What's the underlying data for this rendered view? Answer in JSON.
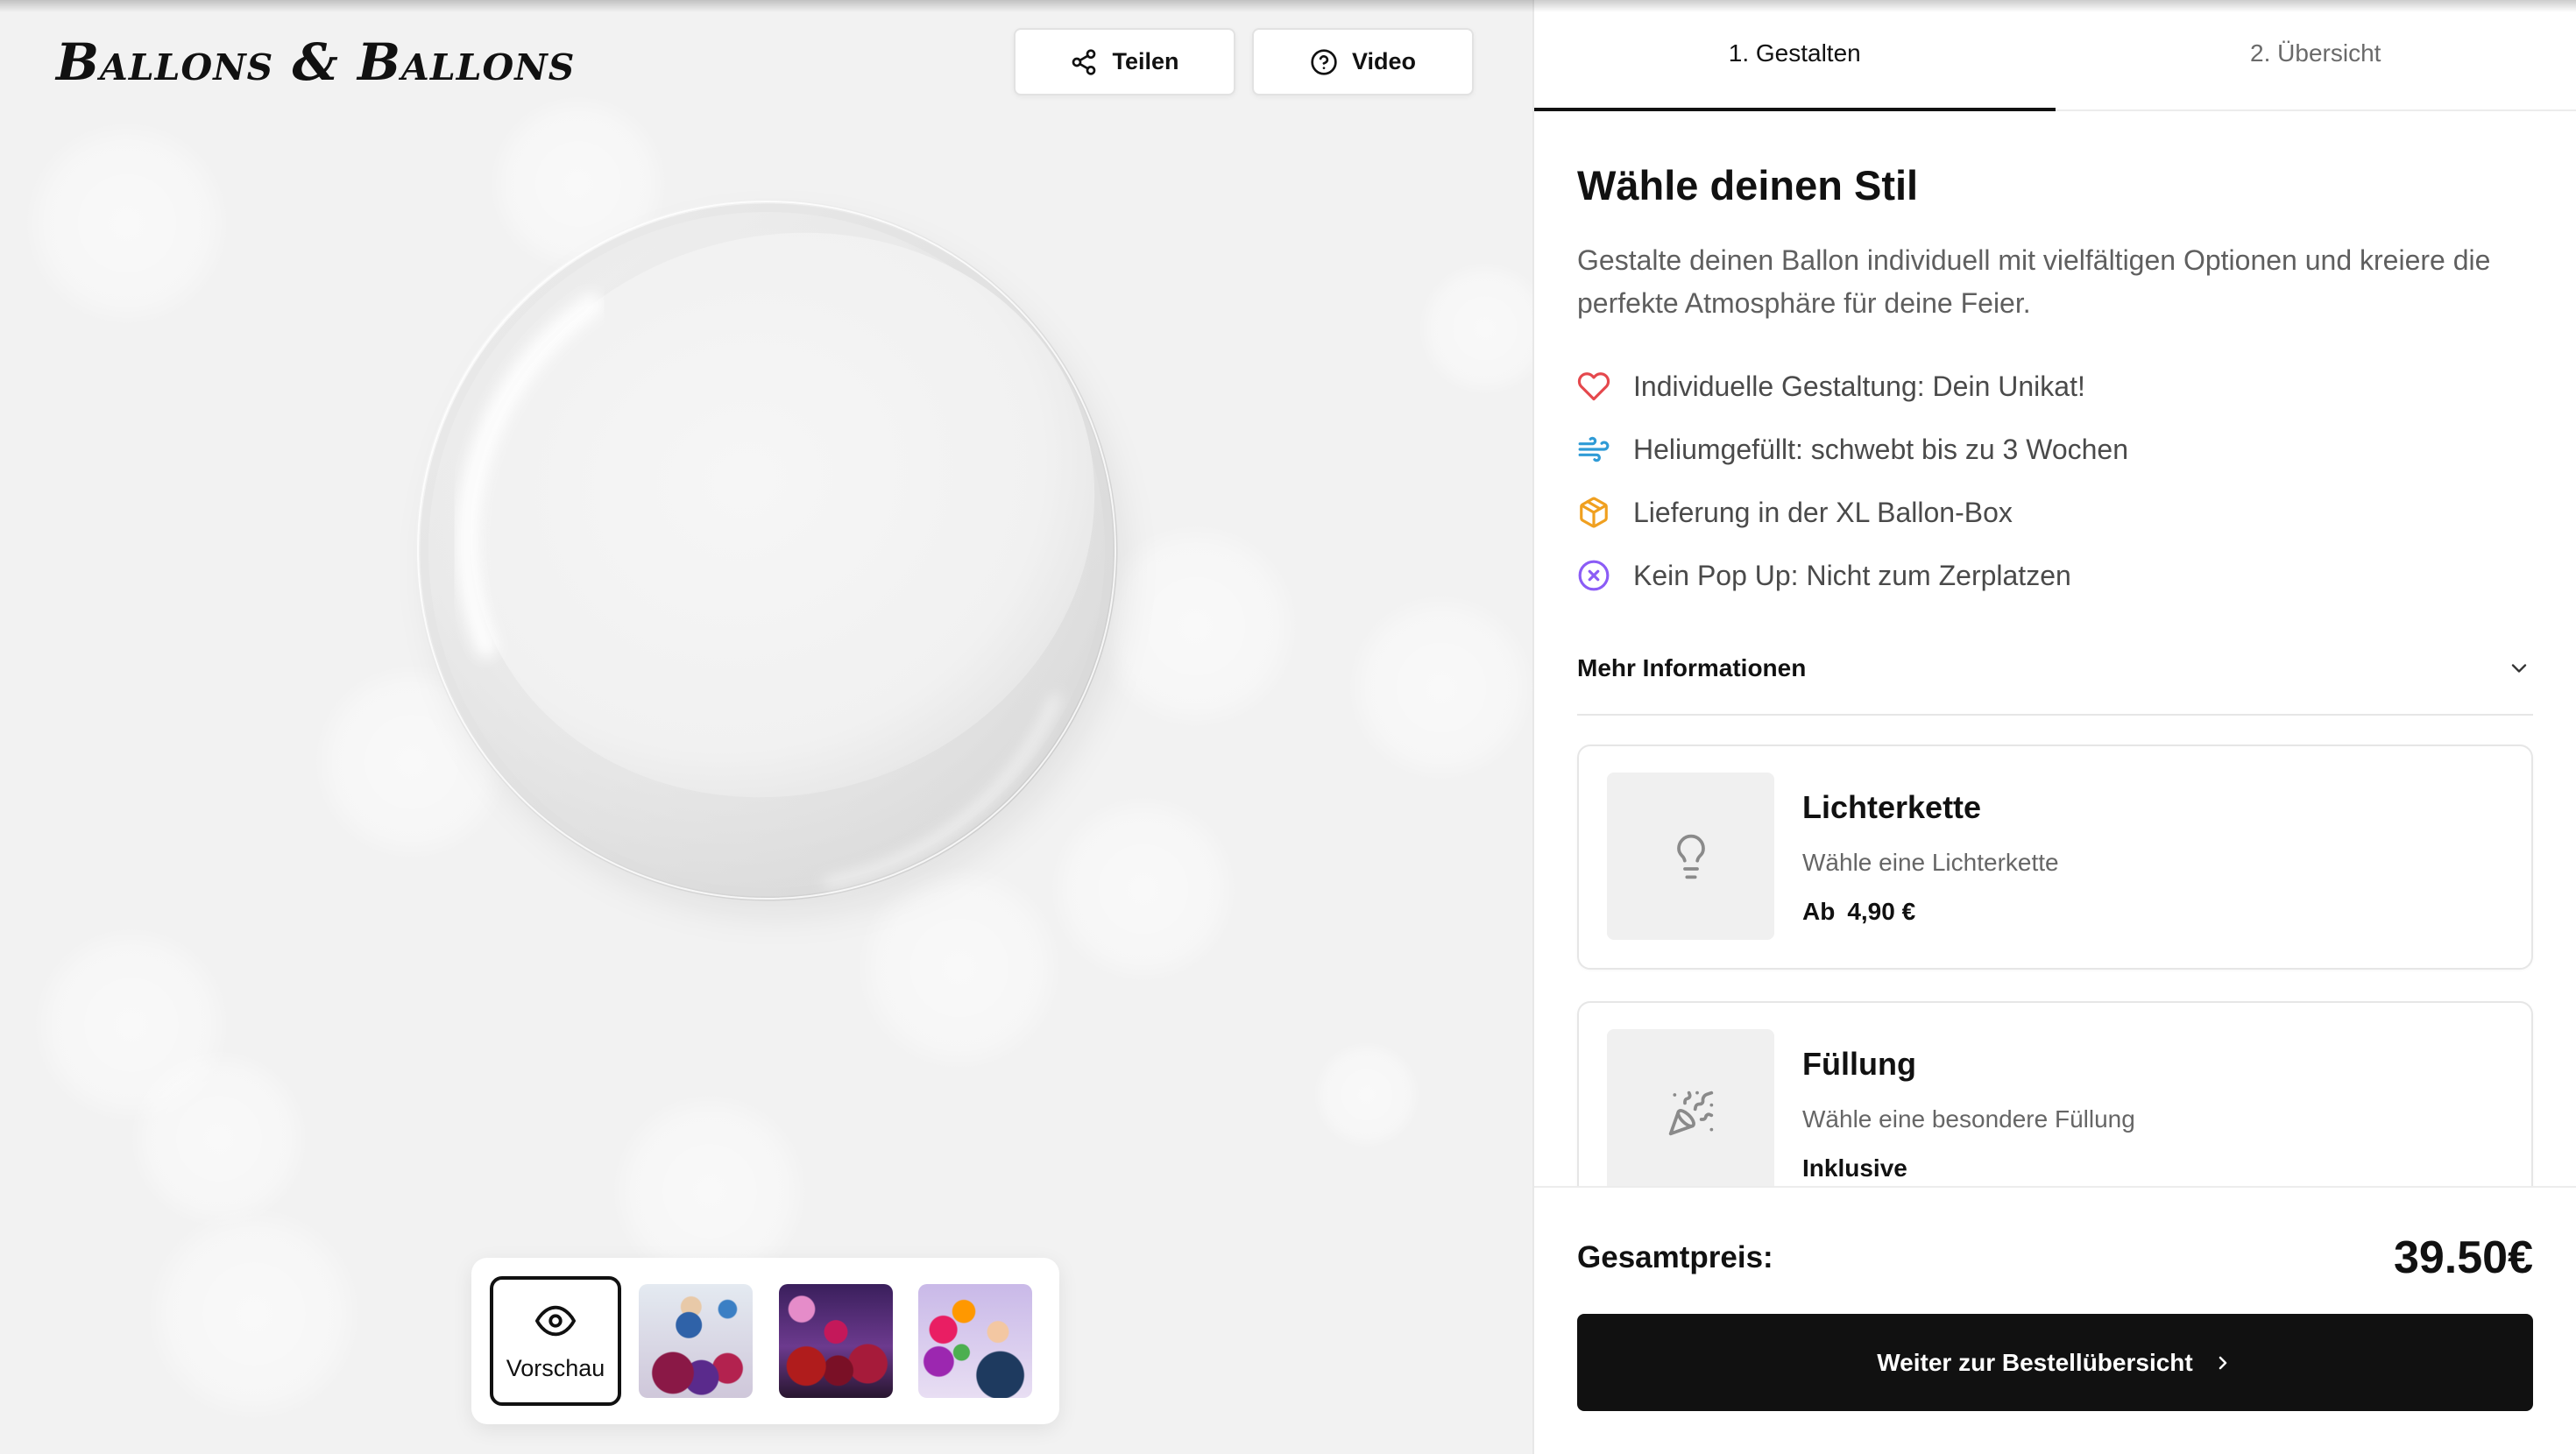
{
  "brand": {
    "logo_text": "Ballons & Ballons"
  },
  "header": {
    "share_button": {
      "label": "Teilen",
      "icon": "share-icon"
    },
    "video_button": {
      "label": "Video",
      "icon": "help-circle-icon"
    }
  },
  "preview": {
    "preview_tile": {
      "label": "Vorschau",
      "icon": "eye-icon"
    }
  },
  "tabs": [
    {
      "label": "1. Gestalten",
      "active": true
    },
    {
      "label": "2. Übersicht",
      "active": false
    }
  ],
  "configurator": {
    "heading": "Wähle deinen Stil",
    "description": "Gestalte deinen Ballon individuell mit vielfältigen Optionen und kreiere die perfekte Atmosphäre für deine Feier.",
    "features": [
      {
        "icon": "heart-icon",
        "color": "#e5484d",
        "text": "Individuelle Gestaltung: Dein Unikat!"
      },
      {
        "icon": "wind-icon",
        "color": "#2f9bd6",
        "text": "Heliumgefüllt: schwebt bis zu 3 Wochen"
      },
      {
        "icon": "package-icon",
        "color": "#f0a020",
        "text": "Lieferung in der XL Ballon-Box"
      },
      {
        "icon": "x-circle-icon",
        "color": "#8b5cf6",
        "text": "Kein Pop Up: Nicht zum Zerplatzen"
      }
    ],
    "more_info_label": "Mehr Informationen"
  },
  "options": [
    {
      "icon": "lightbulb-icon",
      "title": "Lichterkette",
      "subtitle": "Wähle eine Lichterkette",
      "price_prefix": "Ab",
      "price": "4,90 €"
    },
    {
      "icon": "party-popper-icon",
      "title": "Füllung",
      "subtitle": "Wähle eine besondere Füllung",
      "price": "Inklusive"
    }
  ],
  "footer": {
    "total_label": "Gesamtpreis:",
    "total_value": "39.50€",
    "continue_label": "Weiter zur Bestellübersicht"
  },
  "colors": {
    "text": "#111111",
    "muted_text": "#5f5f5f",
    "primary_button_bg": "#111111",
    "primary_button_text": "#ffffff",
    "preview_bg": "#f2f2f2"
  }
}
